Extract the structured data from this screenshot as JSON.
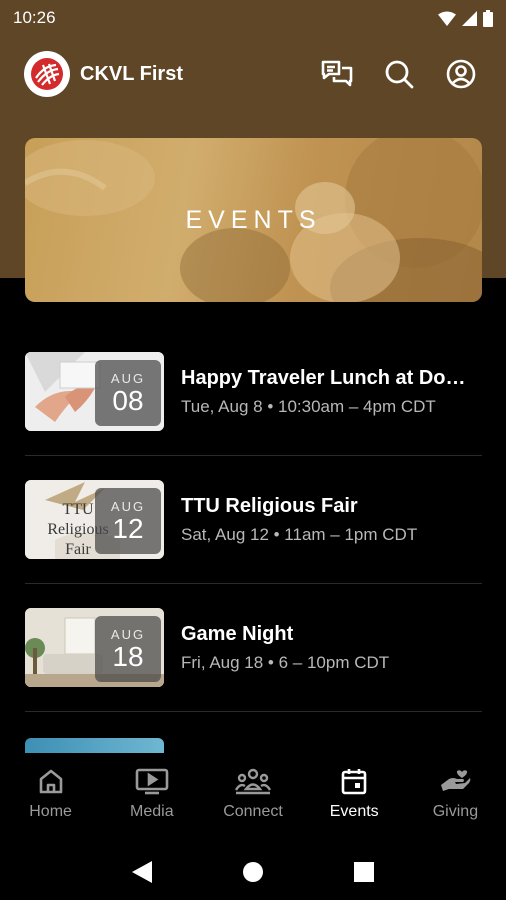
{
  "status_bar": {
    "time": "10:26"
  },
  "header": {
    "title": "CKVL First"
  },
  "banner": {
    "title": "EVENTS"
  },
  "events": [
    {
      "month": "AUG",
      "day": "08",
      "title": "Happy Traveler Lunch at Do…",
      "meta": "Tue, Aug 8 • 10:30am – 4pm CDT",
      "thumb": "typing-hands"
    },
    {
      "month": "AUG",
      "day": "12",
      "title": "TTU Religious Fair",
      "meta": "Sat, Aug 12 • 11am – 1pm CDT",
      "thumb": "religious-fair"
    },
    {
      "month": "AUG",
      "day": "18",
      "title": "Game Night",
      "meta": "Fri, Aug 18 • 6 – 10pm CDT",
      "thumb": "living-room"
    }
  ],
  "thumb_text": {
    "religious_fair": "TTU Religious Fair"
  },
  "bottom_nav": [
    {
      "label": "Home",
      "icon": "home-icon",
      "active": false
    },
    {
      "label": "Media",
      "icon": "media-icon",
      "active": false
    },
    {
      "label": "Connect",
      "icon": "connect-icon",
      "active": false
    },
    {
      "label": "Events",
      "icon": "events-icon",
      "active": true
    },
    {
      "label": "Giving",
      "icon": "giving-icon",
      "active": false
    }
  ],
  "colors": {
    "header_brown": "#5e4626",
    "background": "#000000",
    "inactive_nav": "#9a9a9a",
    "logo_red": "#d32b2b"
  }
}
